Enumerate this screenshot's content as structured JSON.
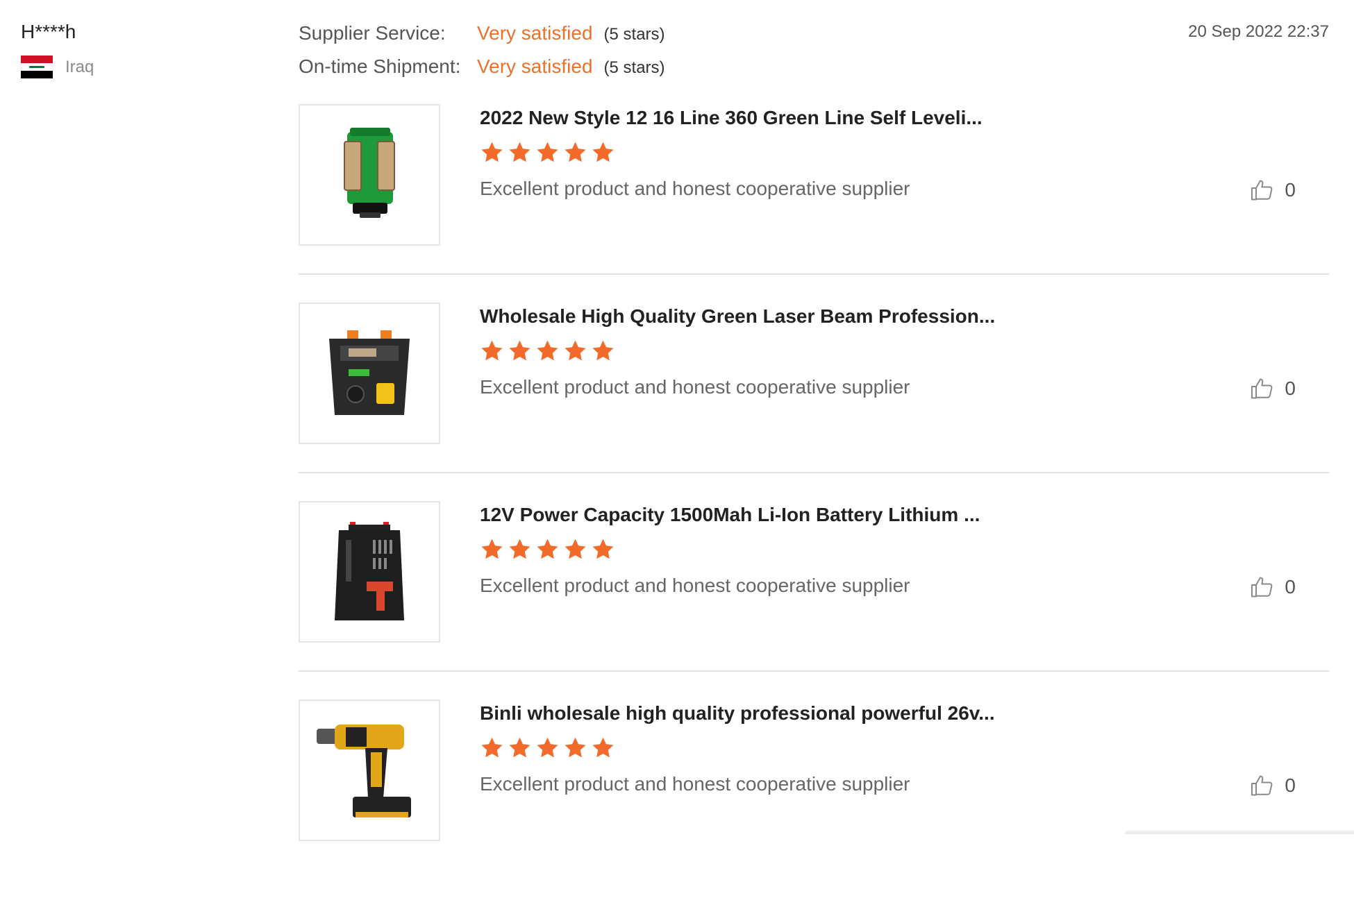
{
  "reviewer": {
    "name": "H****h",
    "country": "Iraq",
    "flag_icon": "iraq-flag-icon"
  },
  "ratings": [
    {
      "label": "Supplier Service:",
      "value": "Very satisfied",
      "stars_text": "(5 stars)"
    },
    {
      "label": "On-time Shipment:",
      "value": "Very satisfied",
      "stars_text": "(5 stars)"
    }
  ],
  "date": "20 Sep 2022 22:37",
  "colors": {
    "accent": "#e8722b",
    "star": "#f26b2b"
  },
  "products": [
    {
      "title": "2022 New Style 12 16 Line 360 Green Line Self Leveli...",
      "stars": 5,
      "comment": "Excellent product and honest cooperative supplier",
      "likes": "0",
      "image_icon": "green-laser-level-icon"
    },
    {
      "title": "Wholesale High Quality Green Laser Beam Profession...",
      "stars": 5,
      "comment": "Excellent product and honest cooperative supplier",
      "likes": "0",
      "image_icon": "laser-kit-case-icon"
    },
    {
      "title": "12V Power Capacity 1500Mah Li-Ion Battery Lithium ...",
      "stars": 5,
      "comment": "Excellent product and honest cooperative supplier",
      "likes": "0",
      "image_icon": "drill-kit-case-icon"
    },
    {
      "title": "Binli wholesale high quality professional powerful 26v...",
      "stars": 5,
      "comment": "Excellent product and honest cooperative supplier",
      "likes": "0",
      "image_icon": "cordless-drill-icon"
    }
  ]
}
